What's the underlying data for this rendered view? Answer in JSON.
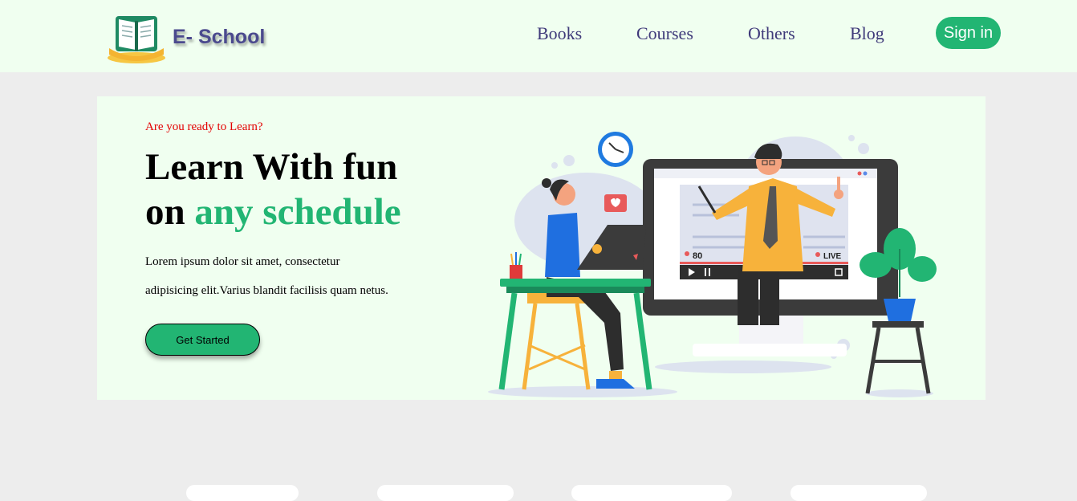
{
  "brand": {
    "name": "E- School"
  },
  "nav": {
    "links": [
      "Books",
      "Courses",
      "Others",
      "Blog"
    ],
    "signin_label": "Sign in"
  },
  "hero": {
    "tagline": "Are you ready to Learn?",
    "headline_line1": "Learn With fun",
    "headline_line2_prefix": "on ",
    "headline_line2_accent": "any schedule",
    "description_line1": "Lorem ipsum dolor sit amet, consectetur",
    "description_line2": "adipisicing elit.Varius blandit facilisis quam netus.",
    "cta_label": "Get Started",
    "illustration": {
      "viewer_count": "80",
      "live_label": "LIVE"
    }
  },
  "colors": {
    "accent_green": "#22b573",
    "nav_text": "#3f3a7a",
    "tagline_red": "#e30000",
    "header_bg": "#f0fff0",
    "page_bg": "#ededed"
  }
}
